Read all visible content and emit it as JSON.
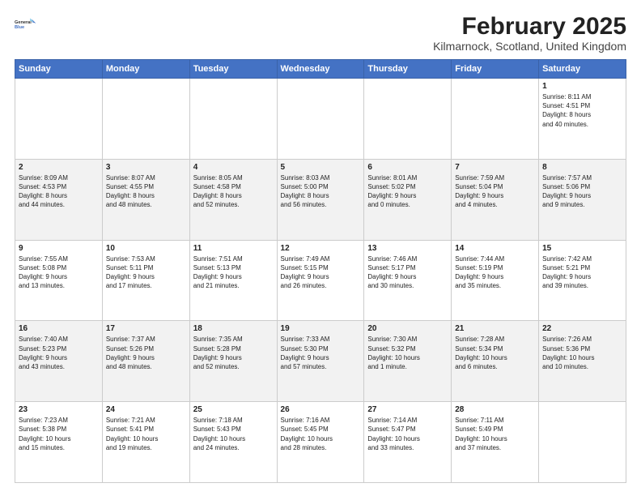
{
  "logo": {
    "line1": "General",
    "line2": "Blue"
  },
  "title": "February 2025",
  "subtitle": "Kilmarnock, Scotland, United Kingdom",
  "days_header": [
    "Sunday",
    "Monday",
    "Tuesday",
    "Wednesday",
    "Thursday",
    "Friday",
    "Saturday"
  ],
  "weeks": [
    [
      {
        "day": "",
        "info": ""
      },
      {
        "day": "",
        "info": ""
      },
      {
        "day": "",
        "info": ""
      },
      {
        "day": "",
        "info": ""
      },
      {
        "day": "",
        "info": ""
      },
      {
        "day": "",
        "info": ""
      },
      {
        "day": "1",
        "info": "Sunrise: 8:11 AM\nSunset: 4:51 PM\nDaylight: 8 hours\nand 40 minutes."
      }
    ],
    [
      {
        "day": "2",
        "info": "Sunrise: 8:09 AM\nSunset: 4:53 PM\nDaylight: 8 hours\nand 44 minutes."
      },
      {
        "day": "3",
        "info": "Sunrise: 8:07 AM\nSunset: 4:55 PM\nDaylight: 8 hours\nand 48 minutes."
      },
      {
        "day": "4",
        "info": "Sunrise: 8:05 AM\nSunset: 4:58 PM\nDaylight: 8 hours\nand 52 minutes."
      },
      {
        "day": "5",
        "info": "Sunrise: 8:03 AM\nSunset: 5:00 PM\nDaylight: 8 hours\nand 56 minutes."
      },
      {
        "day": "6",
        "info": "Sunrise: 8:01 AM\nSunset: 5:02 PM\nDaylight: 9 hours\nand 0 minutes."
      },
      {
        "day": "7",
        "info": "Sunrise: 7:59 AM\nSunset: 5:04 PM\nDaylight: 9 hours\nand 4 minutes."
      },
      {
        "day": "8",
        "info": "Sunrise: 7:57 AM\nSunset: 5:06 PM\nDaylight: 9 hours\nand 9 minutes."
      }
    ],
    [
      {
        "day": "9",
        "info": "Sunrise: 7:55 AM\nSunset: 5:08 PM\nDaylight: 9 hours\nand 13 minutes."
      },
      {
        "day": "10",
        "info": "Sunrise: 7:53 AM\nSunset: 5:11 PM\nDaylight: 9 hours\nand 17 minutes."
      },
      {
        "day": "11",
        "info": "Sunrise: 7:51 AM\nSunset: 5:13 PM\nDaylight: 9 hours\nand 21 minutes."
      },
      {
        "day": "12",
        "info": "Sunrise: 7:49 AM\nSunset: 5:15 PM\nDaylight: 9 hours\nand 26 minutes."
      },
      {
        "day": "13",
        "info": "Sunrise: 7:46 AM\nSunset: 5:17 PM\nDaylight: 9 hours\nand 30 minutes."
      },
      {
        "day": "14",
        "info": "Sunrise: 7:44 AM\nSunset: 5:19 PM\nDaylight: 9 hours\nand 35 minutes."
      },
      {
        "day": "15",
        "info": "Sunrise: 7:42 AM\nSunset: 5:21 PM\nDaylight: 9 hours\nand 39 minutes."
      }
    ],
    [
      {
        "day": "16",
        "info": "Sunrise: 7:40 AM\nSunset: 5:23 PM\nDaylight: 9 hours\nand 43 minutes."
      },
      {
        "day": "17",
        "info": "Sunrise: 7:37 AM\nSunset: 5:26 PM\nDaylight: 9 hours\nand 48 minutes."
      },
      {
        "day": "18",
        "info": "Sunrise: 7:35 AM\nSunset: 5:28 PM\nDaylight: 9 hours\nand 52 minutes."
      },
      {
        "day": "19",
        "info": "Sunrise: 7:33 AM\nSunset: 5:30 PM\nDaylight: 9 hours\nand 57 minutes."
      },
      {
        "day": "20",
        "info": "Sunrise: 7:30 AM\nSunset: 5:32 PM\nDaylight: 10 hours\nand 1 minute."
      },
      {
        "day": "21",
        "info": "Sunrise: 7:28 AM\nSunset: 5:34 PM\nDaylight: 10 hours\nand 6 minutes."
      },
      {
        "day": "22",
        "info": "Sunrise: 7:26 AM\nSunset: 5:36 PM\nDaylight: 10 hours\nand 10 minutes."
      }
    ],
    [
      {
        "day": "23",
        "info": "Sunrise: 7:23 AM\nSunset: 5:38 PM\nDaylight: 10 hours\nand 15 minutes."
      },
      {
        "day": "24",
        "info": "Sunrise: 7:21 AM\nSunset: 5:41 PM\nDaylight: 10 hours\nand 19 minutes."
      },
      {
        "day": "25",
        "info": "Sunrise: 7:18 AM\nSunset: 5:43 PM\nDaylight: 10 hours\nand 24 minutes."
      },
      {
        "day": "26",
        "info": "Sunrise: 7:16 AM\nSunset: 5:45 PM\nDaylight: 10 hours\nand 28 minutes."
      },
      {
        "day": "27",
        "info": "Sunrise: 7:14 AM\nSunset: 5:47 PM\nDaylight: 10 hours\nand 33 minutes."
      },
      {
        "day": "28",
        "info": "Sunrise: 7:11 AM\nSunset: 5:49 PM\nDaylight: 10 hours\nand 37 minutes."
      },
      {
        "day": "",
        "info": ""
      }
    ]
  ]
}
